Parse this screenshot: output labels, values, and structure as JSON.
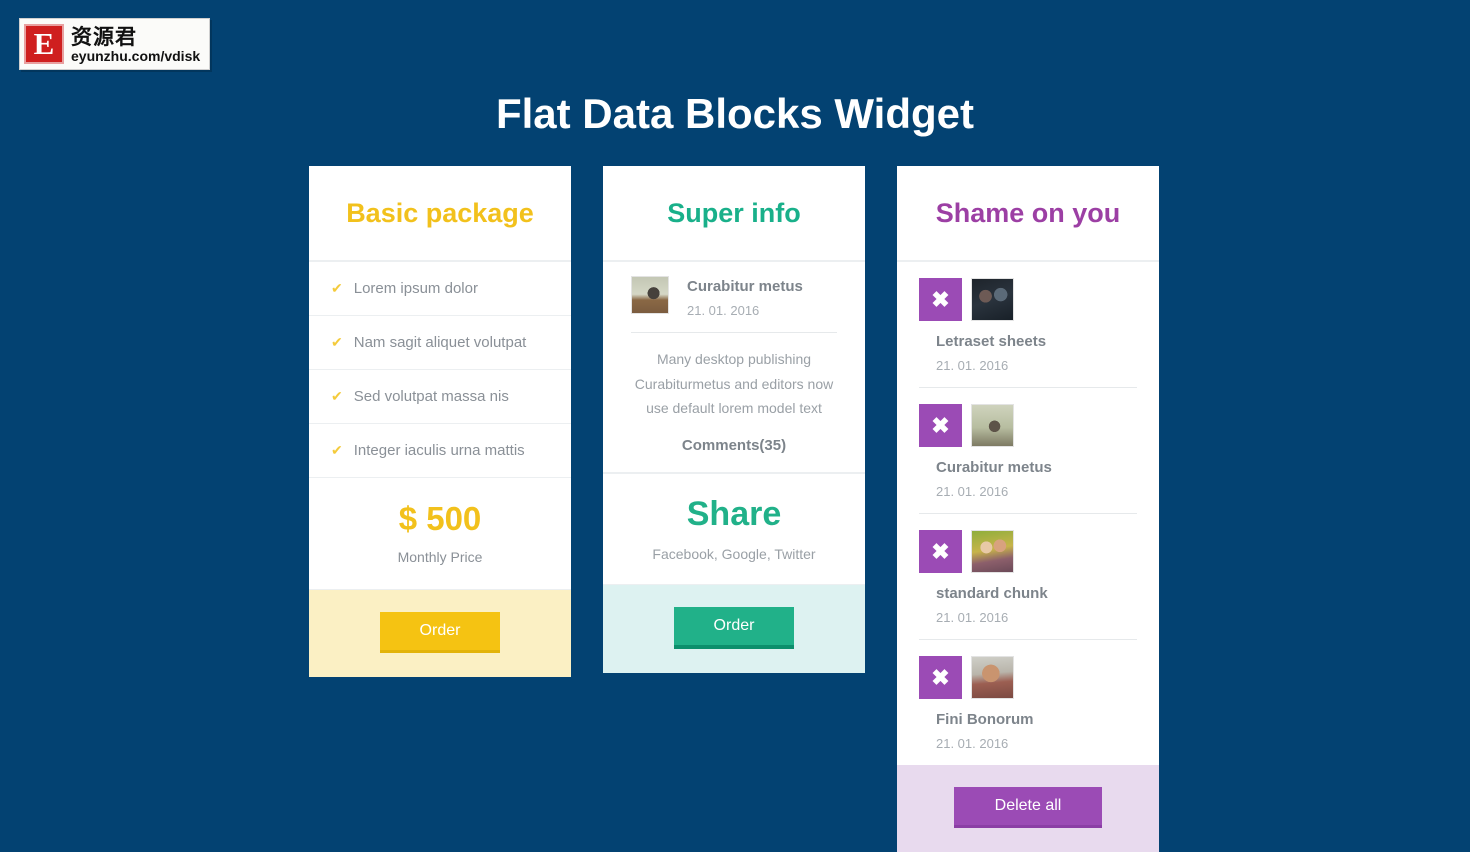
{
  "watermark": {
    "badge_letter": "E",
    "cn_text": "资源君",
    "url": "eyunzhu.com/vdisk"
  },
  "page": {
    "title": "Flat Data Blocks Widget",
    "background_color": "#034272"
  },
  "cards": {
    "basic": {
      "title": "Basic package",
      "accent_color": "#f2c11c",
      "footer_bg": "#fbf0c4",
      "check_icon": "✔",
      "features": [
        "Lorem ipsum dolor",
        "Nam sagit aliquet volutpat",
        "Sed volutpat massa nis",
        "Integer iaculis urna mattis"
      ],
      "price": "$ 500",
      "price_label": "Monthly Price",
      "order_label": "Order"
    },
    "super": {
      "title": "Super info",
      "accent_color": "#19b08a",
      "footer_bg": "#ddf2f1",
      "post_title": "Curabitur metus",
      "post_date": "21. 01. 2016",
      "excerpt": "Many desktop publishing Curabiturmetus and editors now use default lorem model text",
      "comments": "Comments(35)",
      "share_title": "Share",
      "share_networks": "Facebook, Google, Twitter",
      "order_label": "Order"
    },
    "shame": {
      "title": "Shame on you",
      "accent_color": "#9c3fa4",
      "footer_bg": "#e8daee",
      "delete_icon": "✖",
      "items": [
        {
          "name": "Letraset sheets",
          "date": "21. 01. 2016",
          "thumb": "photo-night-couple"
        },
        {
          "name": "Curabitur metus",
          "date": "21. 01. 2016",
          "thumb": "photo-street"
        },
        {
          "name": "standard chunk",
          "date": "21. 01. 2016",
          "thumb": "photo-kids"
        },
        {
          "name": "Fini Bonorum",
          "date": "21. 01. 2016",
          "thumb": "photo-man"
        }
      ],
      "delete_all_label": "Delete all"
    }
  }
}
